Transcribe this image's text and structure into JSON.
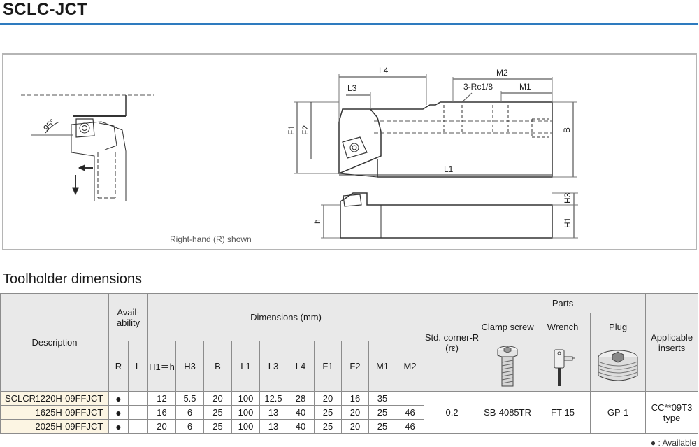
{
  "page": {
    "title": "SCLC-JCT",
    "section_title": "Toolholder dimensions",
    "caption": "Right-hand (R) shown",
    "legend": "● : Available"
  },
  "drawing_labels": {
    "angle": "95°",
    "L4": "L4",
    "L3": "L3",
    "M2": "M2",
    "rc": "3-Rc1/8",
    "M1": "M1",
    "F1": "F1",
    "F2": "F2",
    "B": "B",
    "L1": "L1",
    "H3": "H3",
    "H1": "H1",
    "h": "h"
  },
  "table": {
    "headers": {
      "description": "Description",
      "availability": "Avail-ability",
      "availability_line1": "Avail-",
      "availability_line2": "ability",
      "dimensions": "Dimensions (mm)",
      "std_corner": "Std. corner-R (rε)",
      "std_corner_line1": "Std. corner-R",
      "std_corner_line2": "(rε)",
      "parts": "Parts",
      "clamp_screw": "Clamp screw",
      "wrench": "Wrench",
      "plug": "Plug",
      "applicable_inserts": "Applicable inserts",
      "applicable_line1": "Applicable",
      "applicable_line2": "inserts",
      "R": "R",
      "L": "L",
      "H1h": "H1＝h",
      "H3": "H3",
      "B": "B",
      "L1": "L1",
      "L3": "L3",
      "L4": "L4",
      "F1": "F1",
      "F2": "F2",
      "M1": "M1",
      "M2": "M2"
    },
    "series": "SCLCR",
    "rows": [
      {
        "model": "1220H-09FFJCT",
        "R": "●",
        "L": "",
        "H1h": "12",
        "H3": "5.5",
        "B": "20",
        "L1": "100",
        "L3": "12.5",
        "L4": "28",
        "F1": "20",
        "F2": "16",
        "M1": "35",
        "M2": "–"
      },
      {
        "model": "1625H-09FFJCT",
        "R": "●",
        "L": "",
        "H1h": "16",
        "H3": "6",
        "B": "25",
        "L1": "100",
        "L3": "13",
        "L4": "40",
        "F1": "25",
        "F2": "20",
        "M1": "25",
        "M2": "46"
      },
      {
        "model": "2025H-09FFJCT",
        "R": "●",
        "L": "",
        "H1h": "20",
        "H3": "6",
        "B": "25",
        "L1": "100",
        "L3": "13",
        "L4": "40",
        "F1": "25",
        "F2": "20",
        "M1": "25",
        "M2": "46"
      }
    ],
    "std_corner_value": "0.2",
    "clamp_screw_value": "SB-4085TR",
    "wrench_value": "FT-15",
    "plug_value": "GP-1",
    "inserts_line1": "CC**09T3",
    "inserts_line2": "type"
  },
  "colors": {
    "title_rule": "#2e7bbf",
    "description_bg": "#fcf5e3",
    "header_bg": "#e9e9e9"
  }
}
